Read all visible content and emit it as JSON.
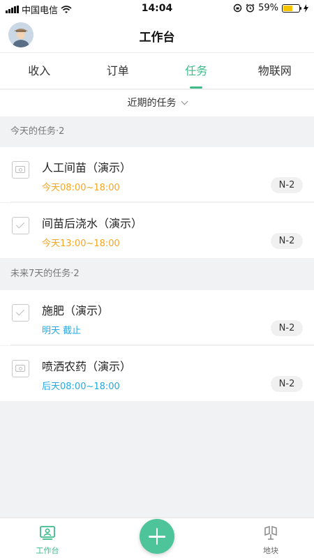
{
  "status_bar": {
    "carrier": "中国电信",
    "time": "14:04",
    "battery_percent": "59%",
    "battery_level": 0.59,
    "icons": [
      "signal-icon",
      "wifi-icon",
      "rotation-lock-icon",
      "alarm-icon",
      "battery-icon",
      "charging-icon"
    ]
  },
  "header": {
    "title": "工作台"
  },
  "tabs": [
    {
      "label": "收入",
      "active": false
    },
    {
      "label": "订单",
      "active": false
    },
    {
      "label": "任务",
      "active": true
    },
    {
      "label": "物联网",
      "active": false
    }
  ],
  "filter": {
    "label": "近期的任务"
  },
  "sections": [
    {
      "header": "今天的任务·2",
      "tasks": [
        {
          "title": "人工间苗（演示）",
          "time": "今天08:00~18:00",
          "badge": "N-2",
          "icon": "camera-icon",
          "time_color": "#f5a623"
        },
        {
          "title": "间苗后浇水（演示）",
          "time": "今天13:00~18:00",
          "badge": "N-2",
          "icon": "checkbox-icon",
          "time_color": "#f5a623"
        }
      ]
    },
    {
      "header": "未来7天的任务·2",
      "tasks": [
        {
          "title": "施肥（演示）",
          "time": "明天 截止",
          "badge": "N-2",
          "icon": "checkbox-icon",
          "time_color": "#27a9e3"
        },
        {
          "title": "喷洒农药（演示）",
          "time": "后天08:00~18:00",
          "badge": "N-2",
          "icon": "camera-icon",
          "time_color": "#27a9e3"
        }
      ]
    }
  ],
  "bottom_nav": {
    "workbench_label": "工作台",
    "plots_label": "地块",
    "add_icon": "plus-icon"
  },
  "colors": {
    "accent": "#3dbb8b",
    "fab": "#4dc49a",
    "today_time": "#f5a623",
    "future_time": "#27a9e3"
  }
}
